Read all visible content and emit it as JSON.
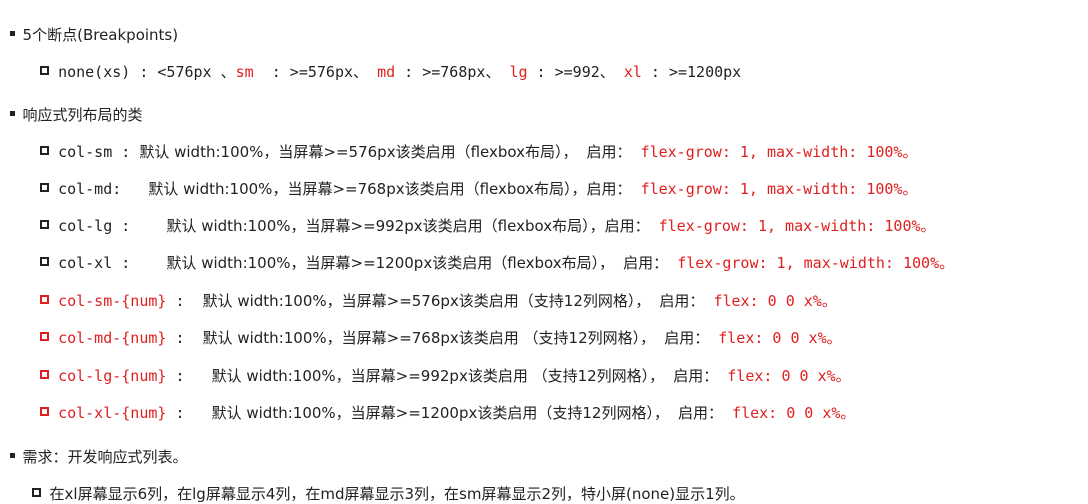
{
  "sections": {
    "breakpoints": {
      "heading": "5个断点(Breakpoints)",
      "items": [
        {
          "a": "none(xs)",
          "b": " : <576px 、",
          "sm": "sm",
          "c": "  : >=576px、 ",
          "md": "md",
          "d": " : >=768px、 ",
          "lg": "lg",
          "e": " : >=992、 ",
          "xl": "xl",
          "f": " : >=1200px"
        }
      ]
    },
    "responsive": {
      "heading": "响应式列布局的类",
      "items": [
        {
          "name": "col-sm",
          "sep": " : ",
          "default": "默认 ",
          "desc": "width:100%，当屏幕>=576px该类启用（flexbox布局），",
          "enable": "启用：",
          "rule": "flex-grow: 1, max-width: 100%。"
        },
        {
          "name": "col-md",
          "sep": ":   ",
          "default": "默认 ",
          "desc": "width:100%，当屏幕>=768px该类启用（flexbox布局），",
          "enable": "启用：",
          "rule": "flex-grow: 1, max-width: 100%。"
        },
        {
          "name": "col-lg",
          "sep": " :    ",
          "default": "默认 ",
          "desc": "width:100%，当屏幕>=992px该类启用（flexbox布局），",
          "enable": "启用：",
          "rule": "flex-grow: 1, max-width: 100%。"
        },
        {
          "name": "col-xl",
          "sep": " :    ",
          "default": "默认 ",
          "desc": "width:100%，当屏幕>=1200px该类启用（flexbox布局），",
          "enable": "启用：",
          "rule": "flex-grow: 1, max-width: 100%。"
        },
        {
          "name": "col-sm-{num}",
          "sep": " :  ",
          "default": "默认 ",
          "desc": "width:100%，当屏幕>=576px该类启用（支持12列网格），",
          "enable": "启用：",
          "rule": "flex: 0 0 x%。"
        },
        {
          "name": "col-md-{num}",
          "sep": " :  ",
          "default": "默认 ",
          "desc": "width:100%，当屏幕>=768px该类启用 （支持12列网格），",
          "enable": "启用：",
          "rule": "flex: 0 0 x%。"
        },
        {
          "name": "col-lg-{num}",
          "sep": " :   ",
          "default": "默认 ",
          "desc": "width:100%，当屏幕>=992px该类启用 （支持12列网格），",
          "enable": "启用：",
          "rule": "flex: 0 0 x%。"
        },
        {
          "name": "col-xl-{num}",
          "sep": " :   ",
          "default": "默认 ",
          "desc": "width:100%，当屏幕>=1200px该类启用（支持12列网格），",
          "enable": "启用：",
          "rule": "flex: 0 0 x%。"
        }
      ]
    },
    "requirement": {
      "heading": "需求：开发响应式列表。",
      "items": [
        {
          "text": "在xl屏幕显示6列，在lg屏幕显示4列，在md屏幕显示3列，在sm屏幕显示2列，特小屏(none)显示1列。"
        }
      ]
    }
  },
  "colors": {
    "text": "#222222",
    "accent": "#e02020"
  }
}
